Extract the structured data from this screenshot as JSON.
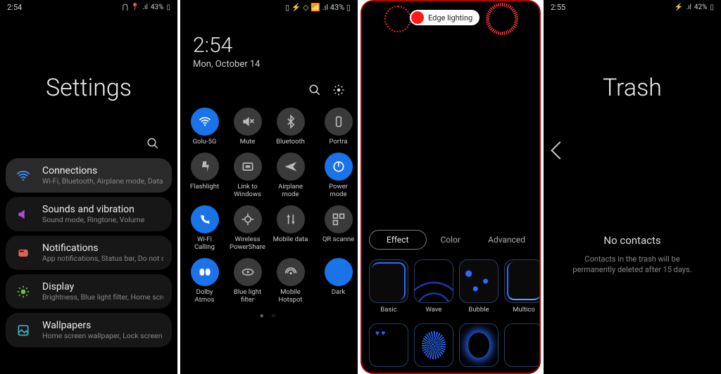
{
  "panel1": {
    "status": {
      "time": "2:54",
      "battery": "43%",
      "icons": "▯ ⛅ ▵"
    },
    "title": "Settings",
    "items": [
      {
        "icon": "wifi",
        "title": "Connections",
        "sub": "Wi-Fi, Bluetooth, Airplane mode, Data usage"
      },
      {
        "icon": "sound",
        "title": "Sounds and vibration",
        "sub": "Sound mode, Ringtone, Volume"
      },
      {
        "icon": "notif",
        "title": "Notifications",
        "sub": "App notifications, Status bar, Do not disturb"
      },
      {
        "icon": "display",
        "title": "Display",
        "sub": "Brightness, Blue light filter, Home screen"
      },
      {
        "icon": "wall",
        "title": "Wallpapers",
        "sub": "Home screen wallpaper, Lock screen wallpap…"
      }
    ]
  },
  "panel2": {
    "status": {
      "right": "▯ ⚡ ◇ 📶 .ıl 43% ▯"
    },
    "clock": "2:54",
    "date": "Mon, October 14",
    "tiles": [
      {
        "label": "Golu-5G",
        "on": true,
        "icon": "wifi"
      },
      {
        "label": "Mute",
        "on": false,
        "icon": "mute"
      },
      {
        "label": "Bluetooth",
        "on": false,
        "icon": "bt"
      },
      {
        "label": "Portra",
        "on": false,
        "icon": "rotate",
        "cut": true
      },
      {
        "label": "Flashlight",
        "on": false,
        "icon": "flash"
      },
      {
        "label": "Link to Windows",
        "on": false,
        "icon": "link"
      },
      {
        "label": "Airplane mode",
        "on": false,
        "icon": "plane"
      },
      {
        "label": "Power mode",
        "on": true,
        "icon": "power",
        "cut": true
      },
      {
        "label": "Wi-Fi Calling",
        "on": true,
        "icon": "wificall"
      },
      {
        "label": "Wireless PowerShare",
        "on": false,
        "icon": "pshare"
      },
      {
        "label": "Mobile data",
        "on": false,
        "icon": "data"
      },
      {
        "label": "QR scanne",
        "on": false,
        "icon": "qr",
        "cut": true
      },
      {
        "label": "Dolby Atmos",
        "on": true,
        "icon": "dolby"
      },
      {
        "label": "Blue light filter",
        "on": false,
        "icon": "eye"
      },
      {
        "label": "Mobile Hotspot",
        "on": false,
        "icon": "hotspot"
      },
      {
        "label": "Dark",
        "on": true,
        "icon": "moon",
        "cut": true
      }
    ]
  },
  "panel3": {
    "chip": "Edge lighting",
    "tabs": {
      "effect": "Effect",
      "color": "Color",
      "advanced": "Advanced"
    },
    "row1": [
      "Basic",
      "Wave",
      "Bubble",
      "Multico"
    ],
    "row2": [
      "",
      "",
      "",
      ""
    ]
  },
  "panel4": {
    "status": {
      "time": "2:55",
      "battery": "42%"
    },
    "title": "Trash",
    "empty": "No contacts",
    "hint": "Contacts in the trash will be permanently deleted after 15 days."
  }
}
